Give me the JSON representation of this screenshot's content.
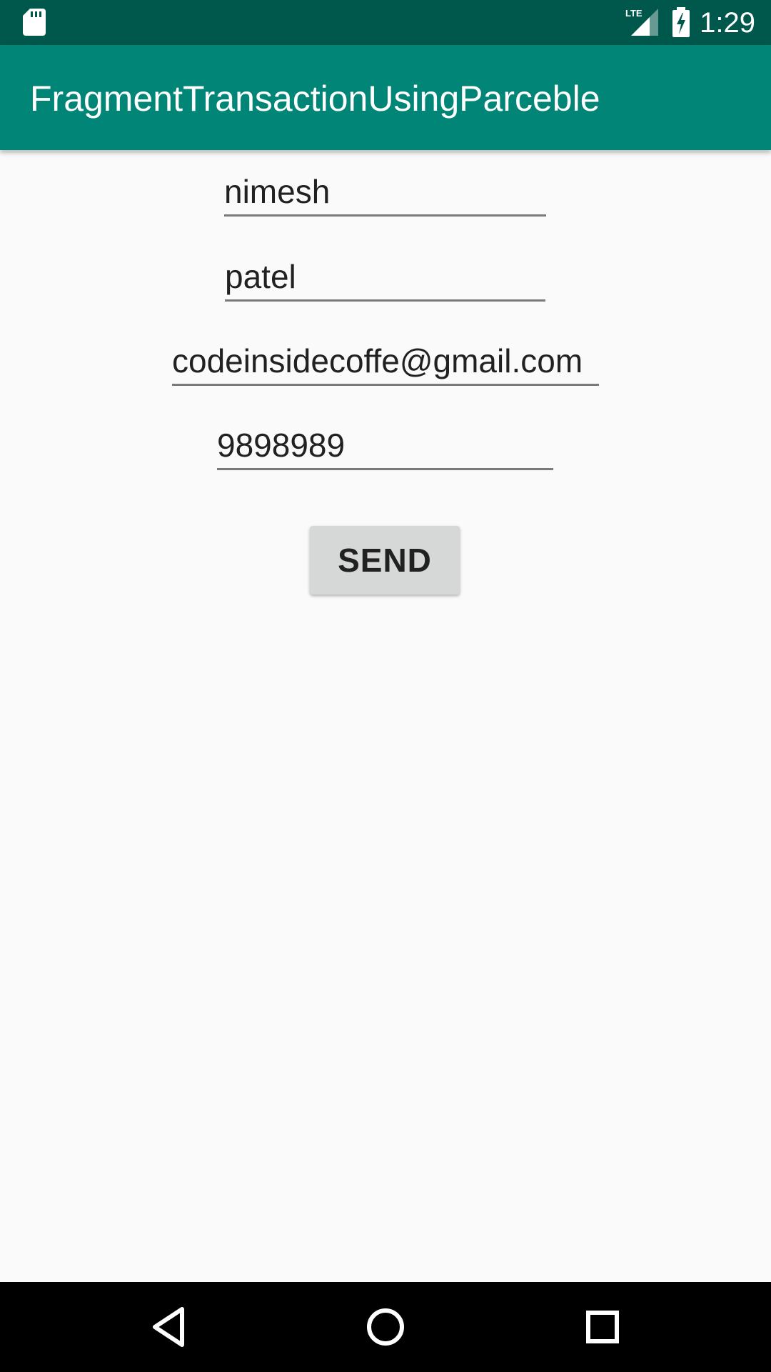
{
  "status_bar": {
    "time": "1:29",
    "network_label": "LTE",
    "icons": [
      "sd-card-icon",
      "lte-signal-icon",
      "battery-charging-icon"
    ],
    "background": "#00574b"
  },
  "app_bar": {
    "title": "FragmentTransactionUsingParceble",
    "background": "#008577"
  },
  "form": {
    "first_name": {
      "value": "nimesh"
    },
    "last_name": {
      "value": "patel"
    },
    "email": {
      "value": "codeinsidecoffe@gmail.com"
    },
    "phone": {
      "value": "9898989"
    },
    "send_label": "SEND"
  },
  "nav_bar": {
    "buttons": [
      "back-icon",
      "home-icon",
      "recents-icon"
    ]
  }
}
